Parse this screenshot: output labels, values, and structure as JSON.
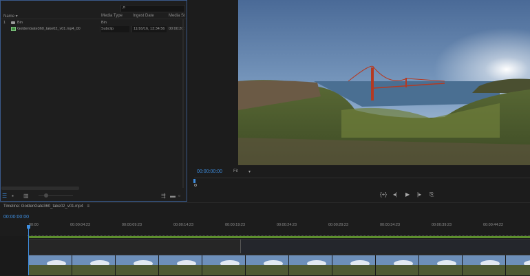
{
  "project": {
    "columns": {
      "name": "Name",
      "media_type": "Media Type",
      "ingest_date": "Ingest Date",
      "media_start": "Media St"
    },
    "rows": [
      {
        "index": "1",
        "name": "Bin",
        "media_type": "Bin",
        "ingest_date": "",
        "media_start": ""
      },
      {
        "index": "",
        "name": "GoldenGate360_take02_v01.mp4_00",
        "media_type": "Subclip",
        "ingest_date": "11/16/16, 13:34:56",
        "media_start": "00:00:20:"
      }
    ],
    "search_icon": "magnifier-icon"
  },
  "monitor": {
    "timecode": "00:00:00:00",
    "fit_label": "Fit",
    "transport": {
      "mark_in": "{+}",
      "step_back": "◂|",
      "play": "▶",
      "step_fwd": "|▸",
      "export_frame": "⎘"
    }
  },
  "timeline": {
    "title": "Timeline: GoldenGate360_take02_v01.mp4",
    "menu_glyph": "≡",
    "timecode": "00:00:00:00",
    "ticks": [
      "00:00",
      "00:00:04:23",
      "00:00:09:23",
      "00:00:14:23",
      "00:00:19:23",
      "00:00:24:23",
      "00:00:29:23",
      "00:00:34:23",
      "00:00:39:23",
      "00:00:44:22"
    ]
  },
  "colors": {
    "accent": "#3e8ee0",
    "panel_border": "#3a5a8a",
    "track_green": "#5d8f2e"
  }
}
